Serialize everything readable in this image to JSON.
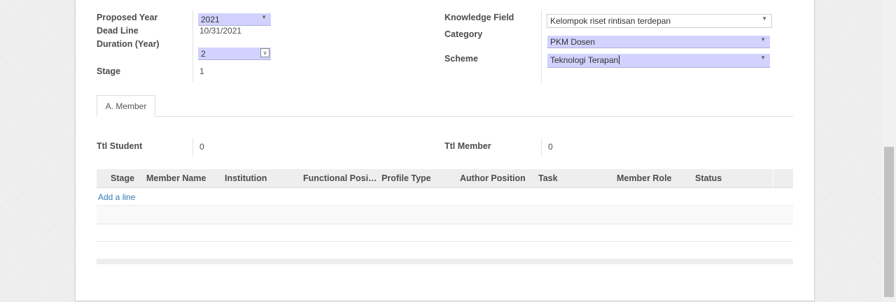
{
  "form": {
    "left": [
      {
        "label": "Proposed Year",
        "value": "2021"
      },
      {
        "label": "Dead Line",
        "value": "10/31/2021"
      },
      {
        "label": "Duration (Year)",
        "value": "2"
      },
      {
        "label": "Stage",
        "value": "1"
      }
    ],
    "right": [
      {
        "label": "Knowledge Field",
        "value": "Kelompok riset rintisan terdepan"
      },
      {
        "label": "Category",
        "value": "PKM Dosen"
      },
      {
        "label": "Scheme",
        "value": "Teknologi Terapan"
      }
    ]
  },
  "tabs": [
    {
      "label": "A. Member"
    }
  ],
  "totals": {
    "student_label": "Ttl Student",
    "student_value": "0",
    "member_label": "Ttl Member",
    "member_value": "0"
  },
  "table": {
    "columns": [
      "Stage",
      "Member Name",
      "Institution",
      "Functional Posi…",
      "Profile Type",
      "Author Position",
      "Task",
      "Member Role",
      "Status"
    ],
    "add_line": "Add a line"
  },
  "icons": {
    "dropdown": "caret-down-icon",
    "spinner": "chevron-down-icon"
  },
  "colors": {
    "required_field": "#d2d2ff",
    "link": "#337ab7",
    "table_header": "#eeeeee"
  }
}
